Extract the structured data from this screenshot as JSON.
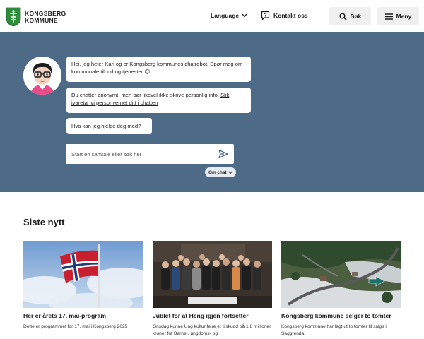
{
  "header": {
    "logo_line1": "KONGSBERG",
    "logo_line2": "KOMMUNE",
    "language_label": "Language",
    "contact_label": "Kontakt oss",
    "search_label": "Søk",
    "menu_label": "Meny"
  },
  "chat": {
    "messages": [
      "Hei, jeg heter Kari og er Kongsberg kommunes chatrobot. Spør meg om kommunale tilbud og tjenester 😊",
      "Du chatter anonymt, men bør likevel ikke skrive personlig info. ",
      "Hva kan jeg hjelpe deg med?"
    ],
    "privacy_link": "Slik ivaretar vi personvernet ditt i chatten",
    "input_placeholder": "Start en samtale eller søk her",
    "about_label": "Om chat"
  },
  "news": {
    "heading": "Siste nytt",
    "items": [
      {
        "title": "Her er årets 17. mai-program",
        "desc": "Dette er programmet for 17. mai i Kongsberg 2025"
      },
      {
        "title": "Jublet for at Heng igjen fortsetter",
        "desc": "Onsdag kunne Ung kultur feire et tilskudd på 1,8 millioner kroner fra Barne-, ungdoms- og"
      },
      {
        "title": "Kongsberg kommune selger to tomter",
        "desc": "Kongsberg kommune har lagt ut to tomter til salgs i Saggrenda."
      }
    ]
  },
  "colors": {
    "hero_bg": "#4d6a86",
    "logo_green": "#2e8b3a",
    "button_bg": "#f0f0f0"
  }
}
